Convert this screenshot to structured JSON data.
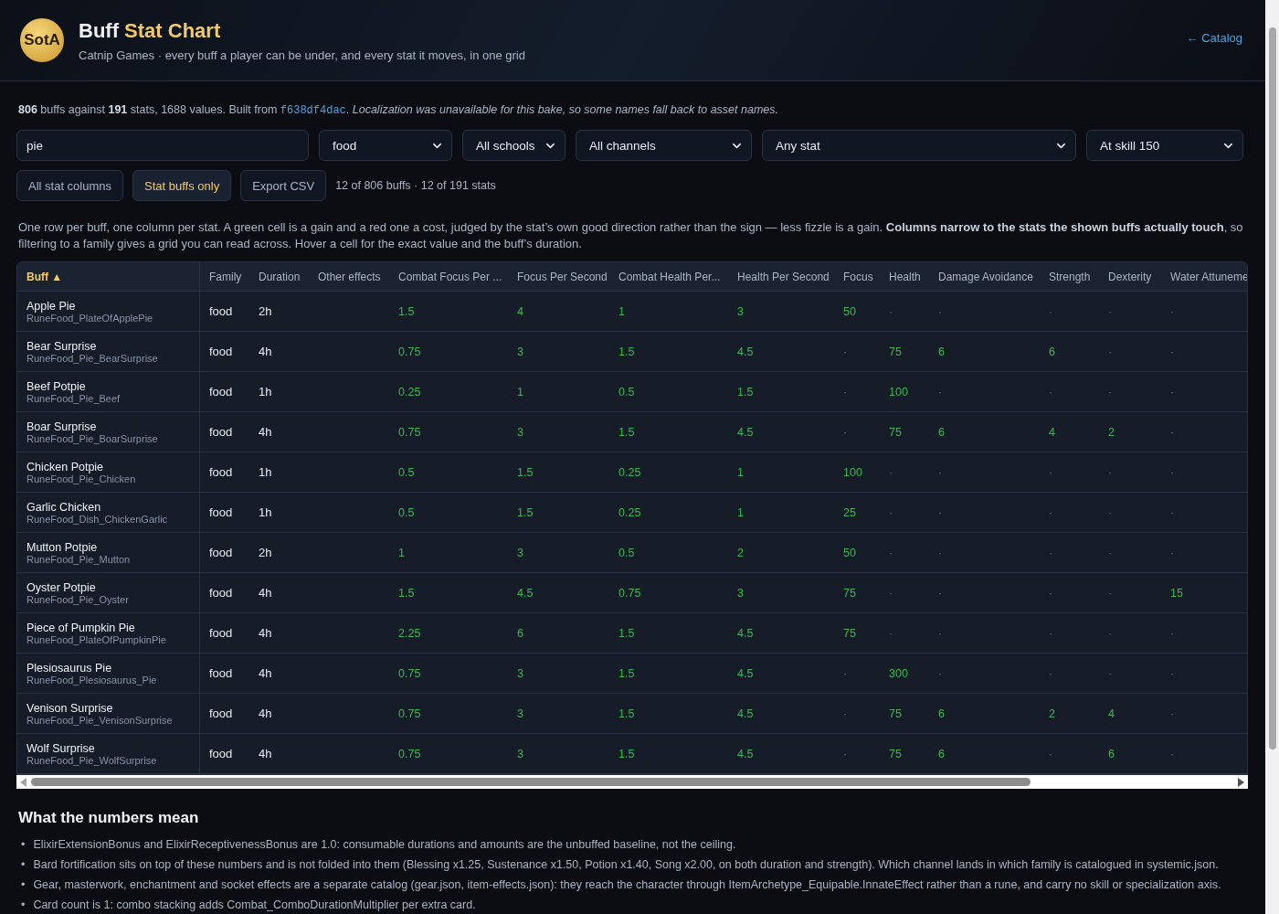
{
  "header": {
    "logo": "SotA",
    "title_lead": "Buff",
    "title_accent": "Stat Chart",
    "subtitle": "Catnip Games · every buff a player can be under, and every stat it moves, in one grid",
    "back_link": "← Catalog"
  },
  "summary": {
    "lead": "**806** buffs against **191** stats, 1688 values. Built from",
    "commit": "f638df4dac",
    "tail": ". *Localization was unavailable for this bake, so some names fall back to asset names.*"
  },
  "filters": {
    "search": "pie",
    "selects": [
      {
        "value": "food"
      },
      {
        "value": "All schools"
      },
      {
        "value": "All channels"
      },
      {
        "value": "Any stat"
      },
      {
        "value": "At skill 150"
      }
    ]
  },
  "buttons": [
    {
      "label": "All stat columns",
      "selected": false
    },
    {
      "label": "Stat buffs only",
      "selected": true
    },
    {
      "label": "Export CSV",
      "selected": false
    }
  ],
  "counts": "12 of 806 buffs · 12 of 191 stats",
  "description": "One row per buff, one column per stat. A green cell is a gain and a red one a cost, judged by the stat’s own good direction rather than the sign — less fizzle is a gain. **Columns narrow to the stats the shown buffs actually touch**, so filtering to a family gives a grid you can read across. Hover a cell for the exact value and the buff’s duration.",
  "table": {
    "sort_column": "Buff",
    "sort_mark": "▲",
    "columns": [
      "Family",
      "Duration",
      "Other effects",
      "Combat Focus Per ...",
      "Focus Per Second",
      "Combat Health Per...",
      "Health Per Second",
      "Focus",
      "Health",
      "Damage Avoidance",
      "Strength",
      "Dexterity",
      "Water Attuneme"
    ],
    "rows": [
      {
        "name": "Apple Pie",
        "asset": "RuneFood_PlateOfApplePie",
        "family": "food",
        "duration": "2h",
        "stats": [
          {
            "value": "1.5",
            "gain": true
          },
          {
            "value": "4",
            "gain": true
          },
          {
            "value": "1",
            "gain": true
          },
          {
            "value": "3",
            "gain": true
          },
          {
            "value": "50",
            "gain": true
          },
          {
            "value": "·",
            "gain": false
          },
          {
            "value": "·",
            "gain": false
          },
          {
            "value": "·",
            "gain": false
          },
          {
            "value": "·",
            "gain": false
          },
          {
            "value": "·",
            "gain": false
          }
        ]
      },
      {
        "name": "Bear Surprise",
        "asset": "RuneFood_Pie_BearSurprise",
        "family": "food",
        "duration": "4h",
        "stats": [
          {
            "value": "0.75",
            "gain": true
          },
          {
            "value": "3",
            "gain": true
          },
          {
            "value": "1.5",
            "gain": true
          },
          {
            "value": "4.5",
            "gain": true
          },
          {
            "value": "·",
            "gain": false
          },
          {
            "value": "75",
            "gain": true
          },
          {
            "value": "6",
            "gain": true
          },
          {
            "value": "6",
            "gain": true
          },
          {
            "value": "·",
            "gain": false
          },
          {
            "value": "·",
            "gain": false
          }
        ]
      },
      {
        "name": "Beef Potpie",
        "asset": "RuneFood_Pie_Beef",
        "family": "food",
        "duration": "1h",
        "stats": [
          {
            "value": "0.25",
            "gain": true
          },
          {
            "value": "1",
            "gain": true
          },
          {
            "value": "0.5",
            "gain": true
          },
          {
            "value": "1.5",
            "gain": true
          },
          {
            "value": "·",
            "gain": false
          },
          {
            "value": "100",
            "gain": true
          },
          {
            "value": "·",
            "gain": false
          },
          {
            "value": "·",
            "gain": false
          },
          {
            "value": "·",
            "gain": false
          },
          {
            "value": "·",
            "gain": false
          }
        ]
      },
      {
        "name": "Boar Surprise",
        "asset": "RuneFood_Pie_BoarSurprise",
        "family": "food",
        "duration": "4h",
        "stats": [
          {
            "value": "0.75",
            "gain": true
          },
          {
            "value": "3",
            "gain": true
          },
          {
            "value": "1.5",
            "gain": true
          },
          {
            "value": "4.5",
            "gain": true
          },
          {
            "value": "·",
            "gain": false
          },
          {
            "value": "75",
            "gain": true
          },
          {
            "value": "6",
            "gain": true
          },
          {
            "value": "4",
            "gain": true
          },
          {
            "value": "2",
            "gain": true
          },
          {
            "value": "·",
            "gain": false
          }
        ]
      },
      {
        "name": "Chicken Potpie",
        "asset": "RuneFood_Pie_Chicken",
        "family": "food",
        "duration": "1h",
        "stats": [
          {
            "value": "0.5",
            "gain": true
          },
          {
            "value": "1.5",
            "gain": true
          },
          {
            "value": "0.25",
            "gain": true
          },
          {
            "value": "1",
            "gain": true
          },
          {
            "value": "100",
            "gain": true
          },
          {
            "value": "·",
            "gain": false
          },
          {
            "value": "·",
            "gain": false
          },
          {
            "value": "·",
            "gain": false
          },
          {
            "value": "·",
            "gain": false
          },
          {
            "value": "·",
            "gain": false
          }
        ]
      },
      {
        "name": "Garlic Chicken",
        "asset": "RuneFood_Dish_ChickenGarlic",
        "family": "food",
        "duration": "1h",
        "stats": [
          {
            "value": "0.5",
            "gain": true
          },
          {
            "value": "1.5",
            "gain": true
          },
          {
            "value": "0.25",
            "gain": true
          },
          {
            "value": "1",
            "gain": true
          },
          {
            "value": "25",
            "gain": true
          },
          {
            "value": "·",
            "gain": false
          },
          {
            "value": "·",
            "gain": false
          },
          {
            "value": "·",
            "gain": false
          },
          {
            "value": "·",
            "gain": false
          },
          {
            "value": "·",
            "gain": false
          }
        ]
      },
      {
        "name": "Mutton Potpie",
        "asset": "RuneFood_Pie_Mutton",
        "family": "food",
        "duration": "2h",
        "stats": [
          {
            "value": "1",
            "gain": true
          },
          {
            "value": "3",
            "gain": true
          },
          {
            "value": "0.5",
            "gain": true
          },
          {
            "value": "2",
            "gain": true
          },
          {
            "value": "50",
            "gain": true
          },
          {
            "value": "·",
            "gain": false
          },
          {
            "value": "·",
            "gain": false
          },
          {
            "value": "·",
            "gain": false
          },
          {
            "value": "·",
            "gain": false
          },
          {
            "value": "·",
            "gain": false
          }
        ]
      },
      {
        "name": "Oyster Potpie",
        "asset": "RuneFood_Pie_Oyster",
        "family": "food",
        "duration": "4h",
        "stats": [
          {
            "value": "1.5",
            "gain": true
          },
          {
            "value": "4.5",
            "gain": true
          },
          {
            "value": "0.75",
            "gain": true
          },
          {
            "value": "3",
            "gain": true
          },
          {
            "value": "75",
            "gain": true
          },
          {
            "value": "·",
            "gain": false
          },
          {
            "value": "·",
            "gain": false
          },
          {
            "value": "·",
            "gain": false
          },
          {
            "value": "·",
            "gain": false
          },
          {
            "value": "15",
            "gain": true
          }
        ]
      },
      {
        "name": "Piece of Pumpkin Pie",
        "asset": "RuneFood_PlateOfPumpkinPie",
        "family": "food",
        "duration": "4h",
        "stats": [
          {
            "value": "2.25",
            "gain": true
          },
          {
            "value": "6",
            "gain": true
          },
          {
            "value": "1.5",
            "gain": true
          },
          {
            "value": "4.5",
            "gain": true
          },
          {
            "value": "75",
            "gain": true
          },
          {
            "value": "·",
            "gain": false
          },
          {
            "value": "·",
            "gain": false
          },
          {
            "value": "·",
            "gain": false
          },
          {
            "value": "·",
            "gain": false
          },
          {
            "value": "·",
            "gain": false
          }
        ]
      },
      {
        "name": "Plesiosaurus Pie",
        "asset": "RuneFood_Plesiosaurus_Pie",
        "family": "food",
        "duration": "4h",
        "stats": [
          {
            "value": "0.75",
            "gain": true
          },
          {
            "value": "3",
            "gain": true
          },
          {
            "value": "1.5",
            "gain": true
          },
          {
            "value": "4.5",
            "gain": true
          },
          {
            "value": "·",
            "gain": false
          },
          {
            "value": "300",
            "gain": true
          },
          {
            "value": "·",
            "gain": false
          },
          {
            "value": "·",
            "gain": false
          },
          {
            "value": "·",
            "gain": false
          },
          {
            "value": "·",
            "gain": false
          }
        ]
      },
      {
        "name": "Venison Surprise",
        "asset": "RuneFood_Pie_VenisonSurprise",
        "family": "food",
        "duration": "4h",
        "stats": [
          {
            "value": "0.75",
            "gain": true
          },
          {
            "value": "3",
            "gain": true
          },
          {
            "value": "1.5",
            "gain": true
          },
          {
            "value": "4.5",
            "gain": true
          },
          {
            "value": "·",
            "gain": false
          },
          {
            "value": "75",
            "gain": true
          },
          {
            "value": "6",
            "gain": true
          },
          {
            "value": "2",
            "gain": true
          },
          {
            "value": "4",
            "gain": true
          },
          {
            "value": "·",
            "gain": false
          }
        ]
      },
      {
        "name": "Wolf Surprise",
        "asset": "RuneFood_Pie_WolfSurprise",
        "family": "food",
        "duration": "4h",
        "stats": [
          {
            "value": "0.75",
            "gain": true
          },
          {
            "value": "3",
            "gain": true
          },
          {
            "value": "1.5",
            "gain": true
          },
          {
            "value": "4.5",
            "gain": true
          },
          {
            "value": "·",
            "gain": false
          },
          {
            "value": "75",
            "gain": true
          },
          {
            "value": "6",
            "gain": true
          },
          {
            "value": "·",
            "gain": false
          },
          {
            "value": "6",
            "gain": true
          },
          {
            "value": "·",
            "gain": false
          }
        ]
      }
    ]
  },
  "notes": {
    "heading": "What the numbers mean",
    "bullet": "•",
    "items": [
      "ElixirExtensionBonus and ElixirReceptivenessBonus are 1.0: consumable durations and amounts are the unbuffed baseline, not the ceiling.",
      "Bard fortification sits on top of these numbers and is not folded into them (Blessing x1.25, Sustenance x1.50, Potion x1.40, Song x2.00, on both duration and strength). Which channel lands in which family is catalogued in systemic.json.",
      "Gear, masterwork, enchantment and socket effects are a separate catalog (gear.json, item-effects.json): they reach the character through ItemArchetype_Equipable.InnateEffect rather than a rune, and carry no skill or specialization axis.",
      "Card count is 1: combo stacking adds Combat_ComboDurationMultiplier per extra card."
    ]
  }
}
